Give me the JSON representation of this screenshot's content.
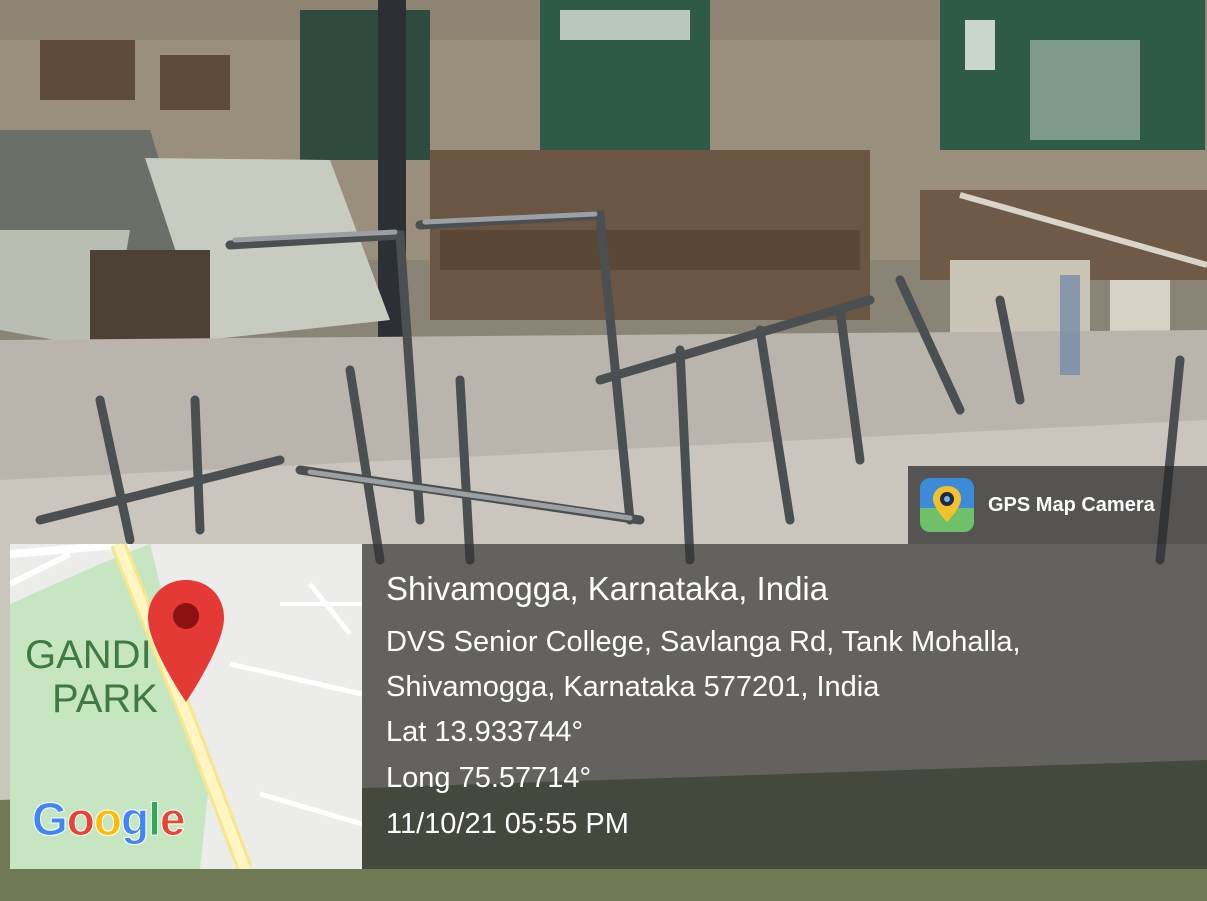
{
  "overlay": {
    "app_name": "GPS Map Camera",
    "place": "Shivamogga, Karnataka, India",
    "address_line1": "DVS Senior College, Savlanga Rd, Tank Mohalla,",
    "address_line2": "Shivamogga, Karnataka 577201, India",
    "latitude": "Lat 13.933744°",
    "longitude": "Long 75.57714°",
    "datetime": "11/10/21 05:55 PM"
  },
  "map": {
    "park_line1": "GANDI",
    "park_line2": "PARK",
    "brand_letters": [
      "G",
      "o",
      "o",
      "g",
      "l",
      "e"
    ],
    "brand_colors": [
      "#4285F4",
      "#EA4335",
      "#FBBC05",
      "#4285F4",
      "#34A853",
      "#EA4335"
    ],
    "pin_color": "#e53935"
  }
}
